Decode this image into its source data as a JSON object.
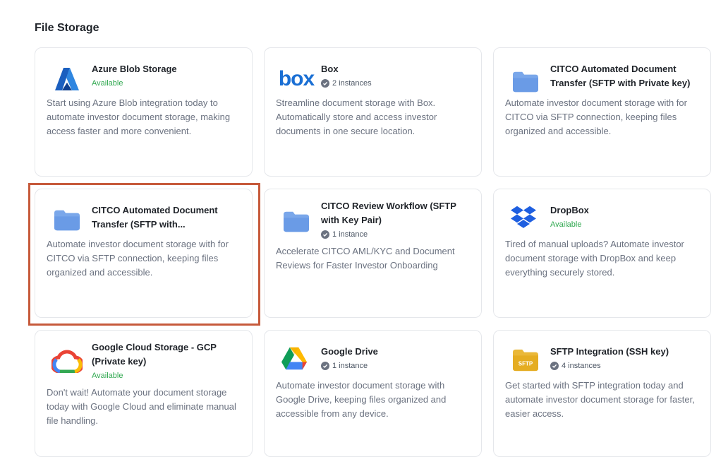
{
  "section_title": "File Storage",
  "colors": {
    "available": "#2fa84f",
    "highlight_border": "#c65a3b",
    "folder_blue": "#7aa7ea",
    "folder_yellow": "#eab838"
  },
  "cards": [
    {
      "title": "Azure Blob Storage",
      "status": "Available",
      "icon": "azure-icon",
      "desc": "Start using Azure Blob integration today to automate investor document storage, making access faster and more convenient."
    },
    {
      "title": "Box",
      "status": "2 instances",
      "icon": "box-logo",
      "logo_text": "box",
      "desc": "Streamline document storage with Box. Automatically store and access investor documents in one secure location."
    },
    {
      "title": "CITCO Automated Document Transfer (SFTP with Private key)",
      "status": "",
      "icon": "folder-icon",
      "desc": "Automate investor document storage with for CITCO via SFTP connection, keeping files organized and accessible."
    },
    {
      "title": "CITCO Automated Document Transfer (SFTP with...",
      "status": "",
      "icon": "folder-icon",
      "desc": "Automate investor document storage with for CITCO via SFTP connection, keeping files organized and accessible."
    },
    {
      "title": "CITCO Review Workflow (SFTP with Key Pair)",
      "status": "1 instance",
      "icon": "folder-icon",
      "desc": "Accelerate CITCO AML/KYC and Document Reviews for Faster Investor Onboarding"
    },
    {
      "title": "DropBox",
      "status": "Available",
      "icon": "dropbox-icon",
      "desc": "Tired of manual uploads? Automate investor document storage with DropBox and keep everything securely stored."
    },
    {
      "title": "Google Cloud Storage - GCP (Private key)",
      "status": "Available",
      "icon": "google-cloud-icon",
      "desc": "Don't wait! Automate your document storage today with Google Cloud and eliminate manual file handling."
    },
    {
      "title": "Google Drive",
      "status": "1 instance",
      "icon": "google-drive-icon",
      "desc": "Automate investor document storage with Google Drive, keeping files organized and accessible from any device."
    },
    {
      "title": "SFTP Integration (SSH key)",
      "status": "4 instances",
      "icon": "sftp-folder-icon",
      "logo_text": "SFTP",
      "desc": "Get started with SFTP integration today and automate investor document storage for faster, easier access."
    }
  ]
}
